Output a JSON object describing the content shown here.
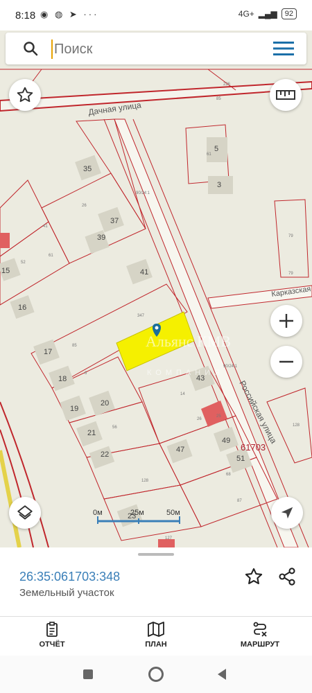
{
  "status_bar": {
    "time": "8:18",
    "left_icons": "◉ ◍ ➤ ···",
    "network": "4G+",
    "battery": "92"
  },
  "search": {
    "placeholder": "Поиск"
  },
  "map": {
    "street_labels": [
      "Дачная улица",
      "Российская улица",
      "Карказская"
    ],
    "building_numbers": [
      "35",
      "37",
      "39",
      "41",
      "15",
      "16",
      "17",
      "18",
      "19",
      "20",
      "21",
      "22",
      "23",
      "43",
      "47",
      "49",
      "51",
      "5",
      "3"
    ],
    "small_labels": [
      "61",
      "26",
      "41",
      "52",
      "85",
      "6",
      "61",
      "56",
      "128",
      "14",
      "26",
      "68",
      "87",
      "79",
      "79",
      "128",
      "347",
      "25",
      "127",
      "226",
      "85",
      "90/24:1",
      "90/24:1"
    ],
    "quarter_label": "61703",
    "watermark_line1": "Альянс КМВ",
    "watermark_line2": "КОМПАНИЯ",
    "scale_labels": [
      "0м",
      "25м",
      "50м"
    ]
  },
  "sheet": {
    "cadastral_number": "26:35:061703:348",
    "object_type": "Земельный участок"
  },
  "nav": {
    "report_label": "ОТЧЁТ",
    "plan_label": "ПЛАН",
    "route_label": "МАРШРУТ"
  },
  "colors": {
    "accent_link": "#3a7fb8",
    "parcel_highlight": "#f5f000",
    "marker": "#1a6e9a",
    "boundary": "#c0262c"
  }
}
